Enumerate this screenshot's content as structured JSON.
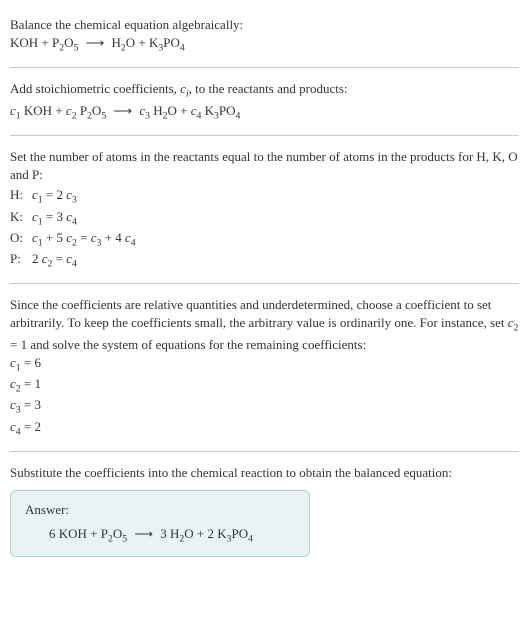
{
  "title": "Balance the chemical equation algebraically:",
  "eq1_html": "KOH + P<sub>2</sub>O<sub>5</sub> <span class='arrow'>⟶</span> H<sub>2</sub>O + K<sub>3</sub>PO<sub>4</sub>",
  "stoich_text_html": "Add stoichiometric coefficients, <span class='italic'>c<sub>i</sub></span>, to the reactants and products:",
  "eq2_html": "<span class='italic'>c</span><sub>1</sub> KOH + <span class='italic'>c</span><sub>2</sub> P<sub>2</sub>O<sub>5</sub> <span class='arrow'>⟶</span> <span class='italic'>c</span><sub>3</sub> H<sub>2</sub>O + <span class='italic'>c</span><sub>4</sub> K<sub>3</sub>PO<sub>4</sub>",
  "atoms_text": "Set the number of atoms in the reactants equal to the number of atoms in the products for H, K, O and P:",
  "atoms": [
    {
      "label": "H:",
      "eq_html": "<span class='italic'>c</span><sub>1</sub> = 2 <span class='italic'>c</span><sub>3</sub>"
    },
    {
      "label": "K:",
      "eq_html": "<span class='italic'>c</span><sub>1</sub> = 3 <span class='italic'>c</span><sub>4</sub>"
    },
    {
      "label": "O:",
      "eq_html": "<span class='italic'>c</span><sub>1</sub> + 5 <span class='italic'>c</span><sub>2</sub> = <span class='italic'>c</span><sub>3</sub> + 4 <span class='italic'>c</span><sub>4</sub>"
    },
    {
      "label": "P:",
      "eq_html": "2 <span class='italic'>c</span><sub>2</sub> = <span class='italic'>c</span><sub>4</sub>"
    }
  ],
  "choose_text_html": "Since the coefficients are relative quantities and underdetermined, choose a coefficient to set arbitrarily. To keep the coefficients small, the arbitrary value is ordinarily one. For instance, set <span class='italic'>c</span><sub>2</sub> = 1 and solve the system of equations for the remaining coefficients:",
  "coeffs": [
    "<span class='italic'>c</span><sub>1</sub> = 6",
    "<span class='italic'>c</span><sub>2</sub> = 1",
    "<span class='italic'>c</span><sub>3</sub> = 3",
    "<span class='italic'>c</span><sub>4</sub> = 2"
  ],
  "substitute_text": "Substitute the coefficients into the chemical reaction to obtain the balanced equation:",
  "answer_label": "Answer:",
  "answer_eq_html": "6 KOH + P<sub>2</sub>O<sub>5</sub> <span class='arrow'>⟶</span> 3 H<sub>2</sub>O + 2 K<sub>3</sub>PO<sub>4</sub>",
  "chart_data": {
    "type": "table",
    "title": "Balanced chemical equation coefficients",
    "unbalanced": "KOH + P2O5 -> H2O + K3PO4",
    "element_equations": {
      "H": "c1 = 2 c3",
      "K": "c1 = 3 c4",
      "O": "c1 + 5 c2 = c3 + 4 c4",
      "P": "2 c2 = c4"
    },
    "solution": {
      "c1": 6,
      "c2": 1,
      "c3": 3,
      "c4": 2
    },
    "balanced": "6 KOH + P2O5 -> 3 H2O + 2 K3PO4"
  }
}
